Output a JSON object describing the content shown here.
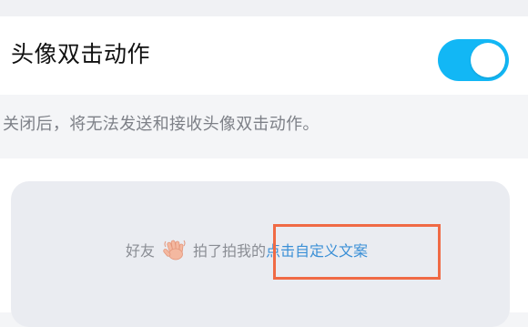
{
  "setting": {
    "label": "头像双击动作",
    "enabled": true
  },
  "note": "关闭后，将无法发送和接收头像双击动作。",
  "preview": {
    "prefix": "好友",
    "action_icon": "waving-hand-icon",
    "middle": "拍了拍我的",
    "custom_link": "点击自定义文案"
  },
  "colors": {
    "toggle_on": "#12b7f5",
    "link": "#3a8fd6",
    "highlight": "#f06a45"
  }
}
